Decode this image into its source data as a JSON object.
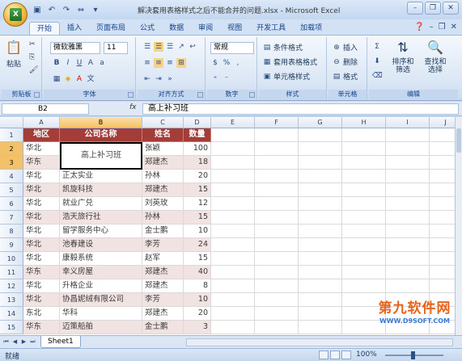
{
  "window": {
    "title": "解决套用表格样式之后不能合并的问题.xlsx - Microsoft Excel",
    "logo_letter": "X"
  },
  "tabs": [
    "开始",
    "插入",
    "页面布局",
    "公式",
    "数据",
    "审阅",
    "视图",
    "开发工具",
    "加载项"
  ],
  "ribbon": {
    "clipboard": {
      "label": "剪贴板",
      "paste": "粘贴"
    },
    "font": {
      "label": "字体",
      "name": "微软雅黑",
      "size": "11"
    },
    "alignment": {
      "label": "对齐方式"
    },
    "number": {
      "label": "数字",
      "format": "常规"
    },
    "styles": {
      "label": "样式",
      "cond": "条件格式",
      "table": "套用表格格式",
      "cell": "单元格样式"
    },
    "cells": {
      "label": "单元格",
      "insert": "插入",
      "delete": "删除",
      "format": "格式"
    },
    "editing": {
      "label": "编辑",
      "sort": "排序和\n筛选",
      "find": "查找和\n选择"
    }
  },
  "formula_bar": {
    "name_box": "B2",
    "fx": "fx",
    "value": "高上补习班"
  },
  "columns": [
    "A",
    "B",
    "C",
    "D",
    "E",
    "F",
    "G",
    "H",
    "I",
    "J"
  ],
  "rows": [
    "1",
    "2",
    "3",
    "4",
    "5",
    "6",
    "7",
    "8",
    "9",
    "10",
    "11",
    "12",
    "13",
    "14",
    "15"
  ],
  "table": {
    "headers": [
      "地区",
      "公司名称",
      "姓名",
      "数量"
    ],
    "merged_value": "高上补习班",
    "data": [
      [
        "华北",
        "",
        "张颖",
        "100"
      ],
      [
        "华东",
        "",
        "郑建杰",
        "18"
      ],
      [
        "华北",
        "正太实业",
        "孙林",
        "20"
      ],
      [
        "华北",
        "凯旋科技",
        "郑建杰",
        "15"
      ],
      [
        "华北",
        "就业广兑",
        "刘英玫",
        "12"
      ],
      [
        "华北",
        "浩天旅行社",
        "孙林",
        "15"
      ],
      [
        "华北",
        "留学服务中心",
        "金士鹏",
        "10"
      ],
      [
        "华北",
        "池春建设",
        "李芳",
        "24"
      ],
      [
        "华北",
        "康毅系统",
        "赵军",
        "15"
      ],
      [
        "华东",
        "幸义房屋",
        "郑建杰",
        "40"
      ],
      [
        "华北",
        "升格企业",
        "郑建杰",
        "8"
      ],
      [
        "华北",
        "协昌妮绒有限公司",
        "李芳",
        "10"
      ],
      [
        "东北",
        "华科",
        "郑建杰",
        "20"
      ],
      [
        "华东",
        "迈策船舶",
        "金士鹏",
        "3"
      ]
    ]
  },
  "sheet_tab": "Sheet1",
  "status": {
    "ready": "就绪",
    "zoom": "100%"
  },
  "watermark": {
    "brand": "第九软件网",
    "url": "WWW.D9SOFT.COM"
  },
  "colors": {
    "header_bg": "#a43d38",
    "band_bg": "#f2e3e3",
    "accent": "#15428b"
  }
}
